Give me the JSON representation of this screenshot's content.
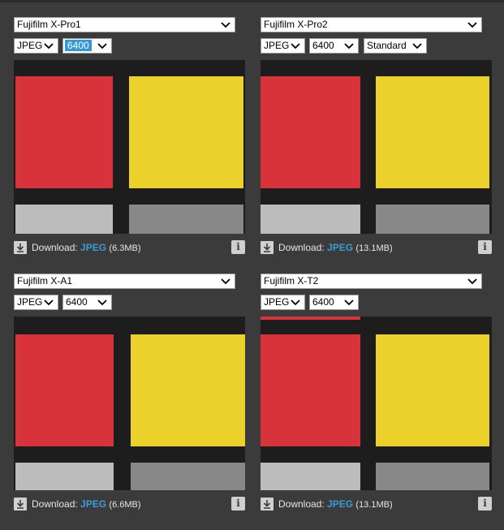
{
  "panels": [
    {
      "camera": "Fujifilm X-Pro1",
      "format": "JPEG",
      "iso": "6400",
      "profile": null,
      "download_label": "Download:",
      "download_format": "JPEG",
      "download_size": "(6.3MB)"
    },
    {
      "camera": "Fujifilm X-Pro2",
      "format": "JPEG",
      "iso": "6400",
      "profile": "Standard",
      "download_label": "Download:",
      "download_format": "JPEG",
      "download_size": "(13.1MB)"
    },
    {
      "camera": "Fujifilm X-A1",
      "format": "JPEG",
      "iso": "6400",
      "profile": null,
      "download_label": "Download:",
      "download_format": "JPEG",
      "download_size": "(6.6MB)"
    },
    {
      "camera": "Fujifilm X-T2",
      "format": "JPEG",
      "iso": "6400",
      "profile": null,
      "download_label": "Download:",
      "download_format": "JPEG",
      "download_size": "(13.1MB)"
    }
  ],
  "colors": {
    "background": "#3b3b3b",
    "link": "#3a9bd9",
    "selection_highlight": "#3399dd",
    "swatch_red": "#d8323b",
    "swatch_yellow": "#ecd12d"
  },
  "icons": {
    "download": "download-arrow-icon",
    "info": "info-icon",
    "dropdown": "chevron-down-icon"
  }
}
